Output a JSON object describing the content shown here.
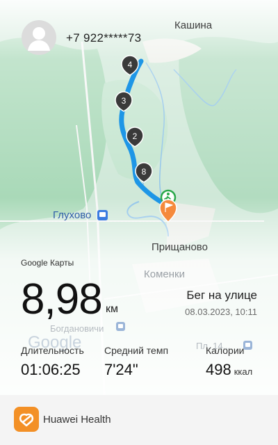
{
  "header": {
    "phone": "+7 922*****73"
  },
  "map": {
    "labels": {
      "kashina": "Кашина",
      "gluhovo": "Глухово",
      "prishchanovo": "Прищаново",
      "komenki": "Коменки",
      "bogdanovichi": "Богдановичи",
      "pl": "Пл. 14..."
    },
    "watermark": "Google",
    "attribution": "Google Карты",
    "km_markers": [
      "4",
      "3",
      "2",
      "8"
    ],
    "route_color": "#1e96e6"
  },
  "activity": {
    "distance": "8,98",
    "distance_unit": "км",
    "type": "Бег на улице",
    "datetime": "08.03.2023, 10:11"
  },
  "stats": {
    "duration": {
      "label": "Длительность",
      "value": "01:06:25"
    },
    "pace": {
      "label": "Средний темп",
      "value": "7'24\""
    },
    "calories": {
      "label": "Калории",
      "value": "498",
      "unit": "ккал"
    }
  },
  "footer": {
    "app_name": "Huawei Health",
    "brand_color": "#f39026"
  }
}
